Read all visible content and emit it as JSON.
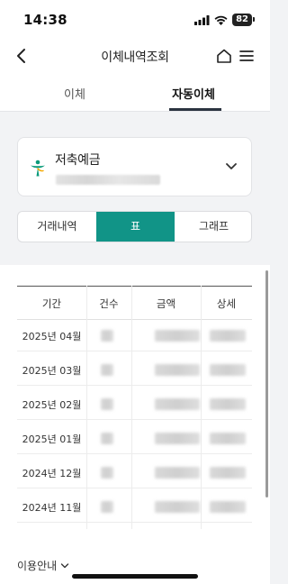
{
  "status_bar": {
    "time": "14:38",
    "battery": "82"
  },
  "header": {
    "title": "이체내역조회"
  },
  "tabs": [
    {
      "label": "이체",
      "active": false
    },
    {
      "label": "자동이체",
      "active": true
    }
  ],
  "account": {
    "name": "저축예금"
  },
  "segments": [
    {
      "label": "거래내역",
      "active": false
    },
    {
      "label": "표",
      "active": true
    },
    {
      "label": "그래프",
      "active": false
    }
  ],
  "table": {
    "headers": [
      "기간",
      "건수",
      "금액",
      "상세"
    ],
    "rows": [
      {
        "period": "2025년 04월"
      },
      {
        "period": "2025년 03월"
      },
      {
        "period": "2025년 02월"
      },
      {
        "period": "2025년 01월"
      },
      {
        "period": "2024년 12월"
      },
      {
        "period": "2024년 11월"
      }
    ]
  },
  "footer": {
    "usage_guide": "이용안내"
  },
  "colors": {
    "accent": "#119487",
    "tab_underline": "#2b3340",
    "logo_green": "#0a9a7a"
  }
}
